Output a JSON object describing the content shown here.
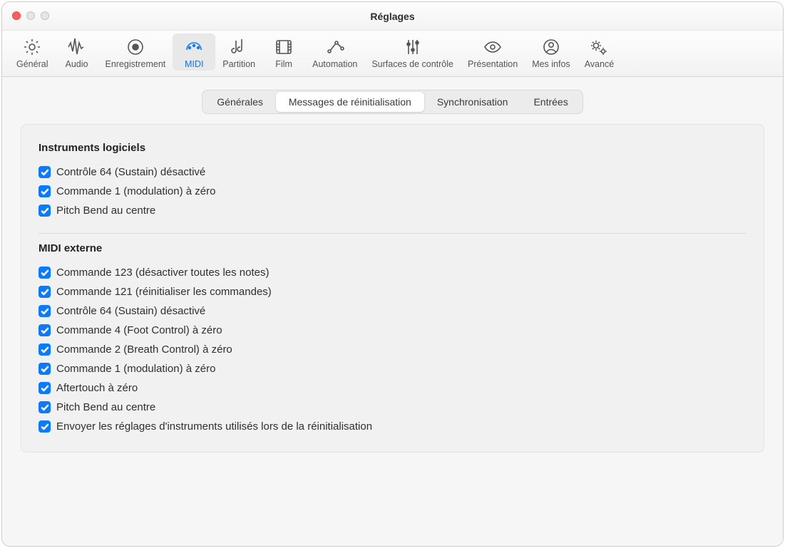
{
  "window": {
    "title": "Réglages"
  },
  "toolbar": {
    "items": [
      {
        "label": "Général",
        "icon": "gear-icon",
        "active": false
      },
      {
        "label": "Audio",
        "icon": "waveform-icon",
        "active": false
      },
      {
        "label": "Enregistrement",
        "icon": "record-icon",
        "active": false
      },
      {
        "label": "MIDI",
        "icon": "midi-icon",
        "active": true
      },
      {
        "label": "Partition",
        "icon": "score-icon",
        "active": false
      },
      {
        "label": "Film",
        "icon": "film-icon",
        "active": false
      },
      {
        "label": "Automation",
        "icon": "automation-icon",
        "active": false
      },
      {
        "label": "Surfaces de contrôle",
        "icon": "sliders-icon",
        "active": false
      },
      {
        "label": "Présentation",
        "icon": "eye-icon",
        "active": false
      },
      {
        "label": "Mes infos",
        "icon": "user-icon",
        "active": false
      },
      {
        "label": "Avancé",
        "icon": "gears-icon",
        "active": false
      }
    ]
  },
  "subnav": {
    "items": [
      {
        "label": "Générales",
        "active": false
      },
      {
        "label": "Messages de réinitialisation",
        "active": true
      },
      {
        "label": "Synchronisation",
        "active": false
      },
      {
        "label": "Entrées",
        "active": false
      }
    ]
  },
  "sections": [
    {
      "title": "Instruments logiciels",
      "items": [
        {
          "label": "Contrôle 64 (Sustain) désactivé",
          "checked": true
        },
        {
          "label": "Commande 1 (modulation) à zéro",
          "checked": true
        },
        {
          "label": "Pitch Bend au centre",
          "checked": true
        }
      ]
    },
    {
      "title": "MIDI externe",
      "items": [
        {
          "label": "Commande 123 (désactiver toutes les notes)",
          "checked": true
        },
        {
          "label": "Commande 121 (réinitialiser les commandes)",
          "checked": true
        },
        {
          "label": "Contrôle 64 (Sustain) désactivé",
          "checked": true
        },
        {
          "label": "Commande 4 (Foot Control) à zéro",
          "checked": true
        },
        {
          "label": "Commande 2 (Breath Control) à zéro",
          "checked": true
        },
        {
          "label": "Commande 1 (modulation) à zéro",
          "checked": true
        },
        {
          "label": "Aftertouch à zéro",
          "checked": true
        },
        {
          "label": "Pitch Bend au centre",
          "checked": true
        },
        {
          "label": "Envoyer les réglages d'instruments utilisés lors de la réinitialisation",
          "checked": true
        }
      ]
    }
  ]
}
